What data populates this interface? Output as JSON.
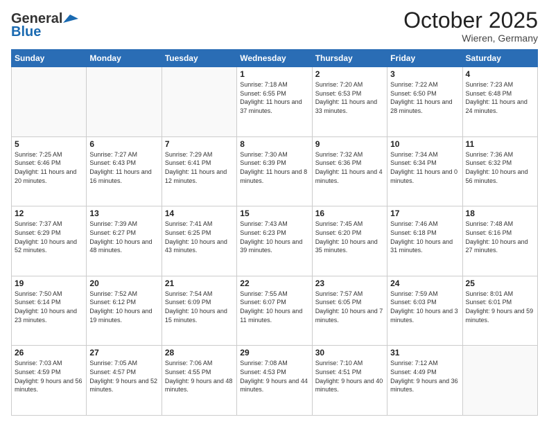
{
  "header": {
    "logo_general": "General",
    "logo_blue": "Blue",
    "month_title": "October 2025",
    "location": "Wieren, Germany"
  },
  "days_of_week": [
    "Sunday",
    "Monday",
    "Tuesday",
    "Wednesday",
    "Thursday",
    "Friday",
    "Saturday"
  ],
  "weeks": [
    [
      {
        "day": "",
        "info": ""
      },
      {
        "day": "",
        "info": ""
      },
      {
        "day": "",
        "info": ""
      },
      {
        "day": "1",
        "info": "Sunrise: 7:18 AM\nSunset: 6:55 PM\nDaylight: 11 hours and 37 minutes."
      },
      {
        "day": "2",
        "info": "Sunrise: 7:20 AM\nSunset: 6:53 PM\nDaylight: 11 hours and 33 minutes."
      },
      {
        "day": "3",
        "info": "Sunrise: 7:22 AM\nSunset: 6:50 PM\nDaylight: 11 hours and 28 minutes."
      },
      {
        "day": "4",
        "info": "Sunrise: 7:23 AM\nSunset: 6:48 PM\nDaylight: 11 hours and 24 minutes."
      }
    ],
    [
      {
        "day": "5",
        "info": "Sunrise: 7:25 AM\nSunset: 6:46 PM\nDaylight: 11 hours and 20 minutes."
      },
      {
        "day": "6",
        "info": "Sunrise: 7:27 AM\nSunset: 6:43 PM\nDaylight: 11 hours and 16 minutes."
      },
      {
        "day": "7",
        "info": "Sunrise: 7:29 AM\nSunset: 6:41 PM\nDaylight: 11 hours and 12 minutes."
      },
      {
        "day": "8",
        "info": "Sunrise: 7:30 AM\nSunset: 6:39 PM\nDaylight: 11 hours and 8 minutes."
      },
      {
        "day": "9",
        "info": "Sunrise: 7:32 AM\nSunset: 6:36 PM\nDaylight: 11 hours and 4 minutes."
      },
      {
        "day": "10",
        "info": "Sunrise: 7:34 AM\nSunset: 6:34 PM\nDaylight: 11 hours and 0 minutes."
      },
      {
        "day": "11",
        "info": "Sunrise: 7:36 AM\nSunset: 6:32 PM\nDaylight: 10 hours and 56 minutes."
      }
    ],
    [
      {
        "day": "12",
        "info": "Sunrise: 7:37 AM\nSunset: 6:29 PM\nDaylight: 10 hours and 52 minutes."
      },
      {
        "day": "13",
        "info": "Sunrise: 7:39 AM\nSunset: 6:27 PM\nDaylight: 10 hours and 48 minutes."
      },
      {
        "day": "14",
        "info": "Sunrise: 7:41 AM\nSunset: 6:25 PM\nDaylight: 10 hours and 43 minutes."
      },
      {
        "day": "15",
        "info": "Sunrise: 7:43 AM\nSunset: 6:23 PM\nDaylight: 10 hours and 39 minutes."
      },
      {
        "day": "16",
        "info": "Sunrise: 7:45 AM\nSunset: 6:20 PM\nDaylight: 10 hours and 35 minutes."
      },
      {
        "day": "17",
        "info": "Sunrise: 7:46 AM\nSunset: 6:18 PM\nDaylight: 10 hours and 31 minutes."
      },
      {
        "day": "18",
        "info": "Sunrise: 7:48 AM\nSunset: 6:16 PM\nDaylight: 10 hours and 27 minutes."
      }
    ],
    [
      {
        "day": "19",
        "info": "Sunrise: 7:50 AM\nSunset: 6:14 PM\nDaylight: 10 hours and 23 minutes."
      },
      {
        "day": "20",
        "info": "Sunrise: 7:52 AM\nSunset: 6:12 PM\nDaylight: 10 hours and 19 minutes."
      },
      {
        "day": "21",
        "info": "Sunrise: 7:54 AM\nSunset: 6:09 PM\nDaylight: 10 hours and 15 minutes."
      },
      {
        "day": "22",
        "info": "Sunrise: 7:55 AM\nSunset: 6:07 PM\nDaylight: 10 hours and 11 minutes."
      },
      {
        "day": "23",
        "info": "Sunrise: 7:57 AM\nSunset: 6:05 PM\nDaylight: 10 hours and 7 minutes."
      },
      {
        "day": "24",
        "info": "Sunrise: 7:59 AM\nSunset: 6:03 PM\nDaylight: 10 hours and 3 minutes."
      },
      {
        "day": "25",
        "info": "Sunrise: 8:01 AM\nSunset: 6:01 PM\nDaylight: 9 hours and 59 minutes."
      }
    ],
    [
      {
        "day": "26",
        "info": "Sunrise: 7:03 AM\nSunset: 4:59 PM\nDaylight: 9 hours and 56 minutes."
      },
      {
        "day": "27",
        "info": "Sunrise: 7:05 AM\nSunset: 4:57 PM\nDaylight: 9 hours and 52 minutes."
      },
      {
        "day": "28",
        "info": "Sunrise: 7:06 AM\nSunset: 4:55 PM\nDaylight: 9 hours and 48 minutes."
      },
      {
        "day": "29",
        "info": "Sunrise: 7:08 AM\nSunset: 4:53 PM\nDaylight: 9 hours and 44 minutes."
      },
      {
        "day": "30",
        "info": "Sunrise: 7:10 AM\nSunset: 4:51 PM\nDaylight: 9 hours and 40 minutes."
      },
      {
        "day": "31",
        "info": "Sunrise: 7:12 AM\nSunset: 4:49 PM\nDaylight: 9 hours and 36 minutes."
      },
      {
        "day": "",
        "info": ""
      }
    ]
  ]
}
